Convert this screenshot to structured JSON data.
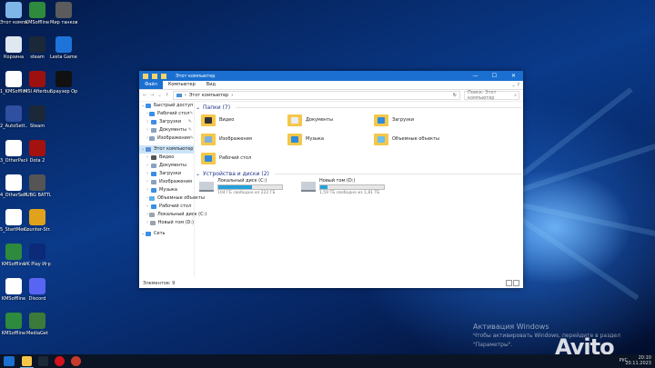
{
  "desktop_icons": [
    {
      "label": "Этот компьютер",
      "color": "#7fb6e8"
    },
    {
      "label": "KMSoffline",
      "color": "#2e8a3c"
    },
    {
      "label": "Мир танков",
      "color": "#5b5b5b"
    },
    {
      "label": "Корзина",
      "color": "#dfe7f0"
    },
    {
      "label": "steam",
      "color": "#1b2838"
    },
    {
      "label": "Lesta Game Center",
      "color": "#1e73d8"
    },
    {
      "label": "1_KMSoffline",
      "color": "#ffffff"
    },
    {
      "label": "MSI Afterburner",
      "color": "#9c1010"
    },
    {
      "label": "Браузер Opera GX",
      "color": "#111111"
    },
    {
      "label": "2_AutoSett...",
      "color": "#2f4fa0"
    },
    {
      "label": "Steam",
      "color": "#1b2838"
    },
    {
      "label": "3_OtherPack",
      "color": "#ffffff"
    },
    {
      "label": "Dota 2",
      "color": "#a3120f"
    },
    {
      "label": "4_OtherSett...",
      "color": "#ffffff"
    },
    {
      "label": "PUBG BATTLEGR...",
      "color": "#555555"
    },
    {
      "label": "5_StartMenu",
      "color": "#ffffff"
    },
    {
      "label": "Counter-Str... Global Offe...",
      "color": "#e0a21a"
    },
    {
      "label": "KMSoffline",
      "color": "#2e8a3c"
    },
    {
      "label": "VK Play Игрове...",
      "color": "#0b2a78"
    },
    {
      "label": "KMSoffline",
      "color": "#ffffff"
    },
    {
      "label": "Discord",
      "color": "#5865f2"
    },
    {
      "label": "KMSoffline",
      "color": "#2e8a3c"
    },
    {
      "label": "MediaGet",
      "color": "#3b7a3a"
    }
  ],
  "window": {
    "title": "Этот компьютер",
    "controls": {
      "minimize": "—",
      "maximize": "☐",
      "close": "✕"
    },
    "ribbon_tabs": [
      "Файл",
      "Компьютер",
      "Вид"
    ],
    "address_path": "Этот компьютер",
    "search_placeholder": "Поиск: Этот компьютер",
    "nav_items": [
      {
        "label": "Быстрый доступ",
        "color": "#3a8ee6",
        "pin": false,
        "sel": false
      },
      {
        "label": "Рабочий стол",
        "color": "#3a8ee6",
        "pin": true,
        "sel": false
      },
      {
        "label": "Загрузки",
        "color": "#3a8ee6",
        "pin": true,
        "sel": false
      },
      {
        "label": "Документы",
        "color": "#8aa2c0",
        "pin": true,
        "sel": false
      },
      {
        "label": "Изображения",
        "color": "#8aa2c0",
        "pin": true,
        "sel": false
      },
      {
        "label": "Этот компьютер",
        "color": "#5a8fd6",
        "pin": false,
        "sel": true
      },
      {
        "label": "Видео",
        "color": "#555555",
        "pin": false,
        "sel": false
      },
      {
        "label": "Документы",
        "color": "#8aa2c0",
        "pin": false,
        "sel": false
      },
      {
        "label": "Загрузки",
        "color": "#3a8ee6",
        "pin": false,
        "sel": false
      },
      {
        "label": "Изображения",
        "color": "#8aa2c0",
        "pin": false,
        "sel": false
      },
      {
        "label": "Музыка",
        "color": "#3a8ee6",
        "pin": false,
        "sel": false
      },
      {
        "label": "Объемные объекты",
        "color": "#5ab0e6",
        "pin": false,
        "sel": false
      },
      {
        "label": "Рабочий стол",
        "color": "#3a8ee6",
        "pin": false,
        "sel": false
      },
      {
        "label": "Локальный диск (C:)",
        "color": "#9aa3ad",
        "pin": false,
        "sel": false
      },
      {
        "label": "Новый том (D:)",
        "color": "#9aa3ad",
        "pin": false,
        "sel": false
      },
      {
        "label": "Сеть",
        "color": "#3a8ee6",
        "pin": false,
        "sel": false
      }
    ],
    "folders_header": "Папки (7)",
    "folders": [
      {
        "name": "Видео",
        "glyph": "#333333"
      },
      {
        "name": "Документы",
        "glyph": "#e8eef7"
      },
      {
        "name": "Загрузки",
        "glyph": "#2d8be0"
      },
      {
        "name": "Изображения",
        "glyph": "#7fb0e0"
      },
      {
        "name": "Музыка",
        "glyph": "#2d8be0"
      },
      {
        "name": "Объемные объекты",
        "glyph": "#6cc0ee"
      },
      {
        "name": "Рабочий стол",
        "glyph": "#2d8be0"
      }
    ],
    "drives_header": "Устройства и диски (2)",
    "drives": [
      {
        "name": "Локальный диск (C:)",
        "free": "104 ГБ свободно из 222 ГБ",
        "used_fraction": 0.53
      },
      {
        "name": "Новый том (D:)",
        "free": "1,59 ТБ свободно из 1,81 ТБ",
        "used_fraction": 0.12
      }
    ],
    "status": "Элементов: 9"
  },
  "watermark": {
    "title": "Активация Windows",
    "subtitle": "Чтобы активировать Windows, перейдите в раздел \"Параметры\"."
  },
  "taskbar": {
    "lang": "РУС",
    "time": "20:10",
    "date": "20.11.2023"
  }
}
